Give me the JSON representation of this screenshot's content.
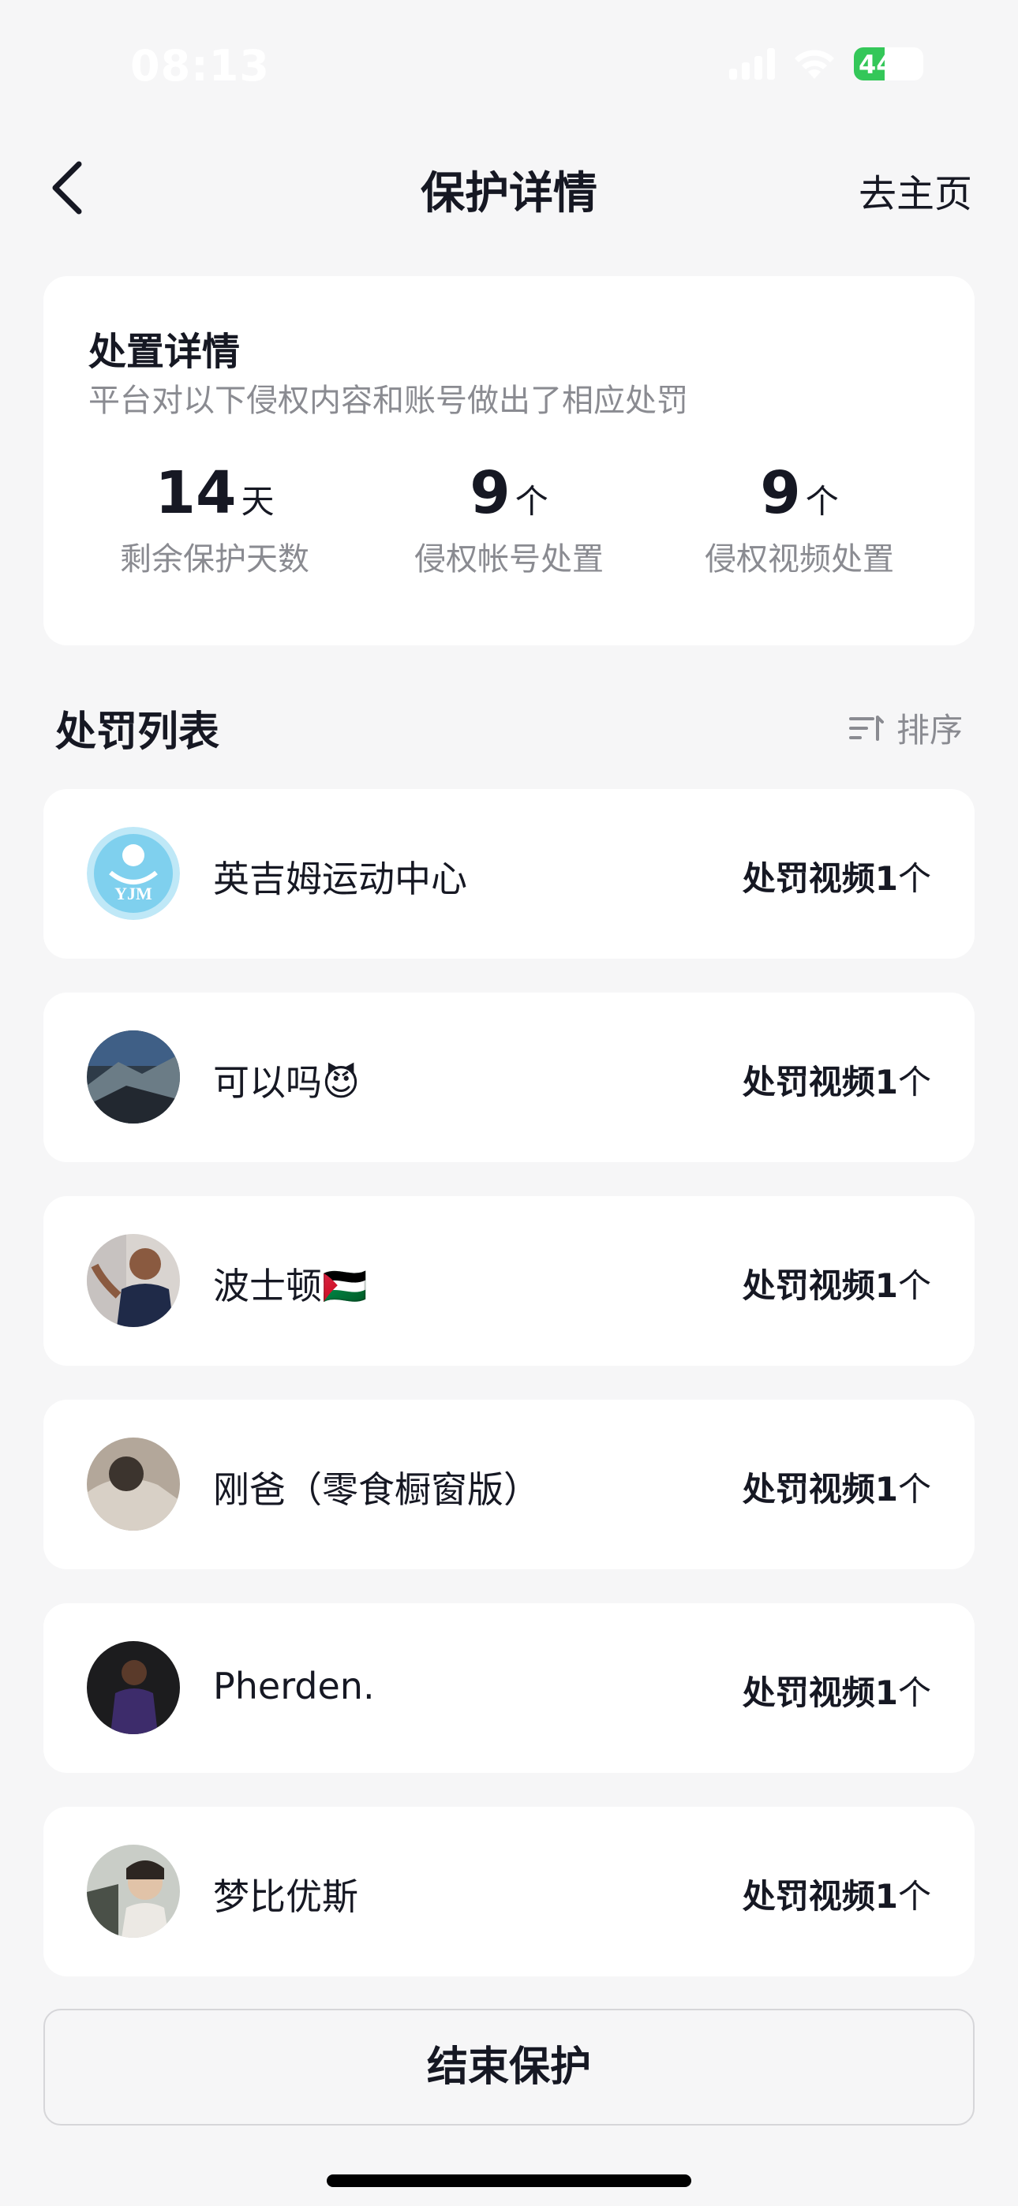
{
  "status_bar": {
    "time": "08:13",
    "battery_text": "44",
    "battery_level_percent": 44,
    "colors": {
      "battery": "#34c759"
    }
  },
  "nav": {
    "title": "保护详情",
    "right_action": "去主页",
    "back_icon": "chevron-left-icon"
  },
  "summary": {
    "title": "处置详情",
    "subtitle": "平台对以下侵权内容和账号做出了相应处罚",
    "stats": [
      {
        "value": "14",
        "unit": "天",
        "label": "剩余保护天数"
      },
      {
        "value": "9",
        "unit": "个",
        "label": "侵权帐号处置"
      },
      {
        "value": "9",
        "unit": "个",
        "label": "侵权视频处置"
      }
    ]
  },
  "list": {
    "title": "处罚列表",
    "sort_label": "排序",
    "sort_icon": "sort-icon",
    "items": [
      {
        "name": "英吉姆运动中心",
        "badge_prefix": "处罚视频1",
        "badge_suffix": "个",
        "avatar_text": "YJM"
      },
      {
        "name": "可以吗😈",
        "badge_prefix": "处罚视频1",
        "badge_suffix": "个"
      },
      {
        "name": "波士顿🇵🇸",
        "badge_prefix": "处罚视频1",
        "badge_suffix": "个"
      },
      {
        "name": "刚爸（零食橱窗版）",
        "badge_prefix": "处罚视频1",
        "badge_suffix": "个"
      },
      {
        "name": "Pherden.",
        "badge_prefix": "处罚视频1",
        "badge_suffix": "个"
      },
      {
        "name": "梦比优斯",
        "badge_prefix": "处罚视频1",
        "badge_suffix": "个"
      }
    ]
  },
  "footer": {
    "end_button": "结束保护"
  }
}
